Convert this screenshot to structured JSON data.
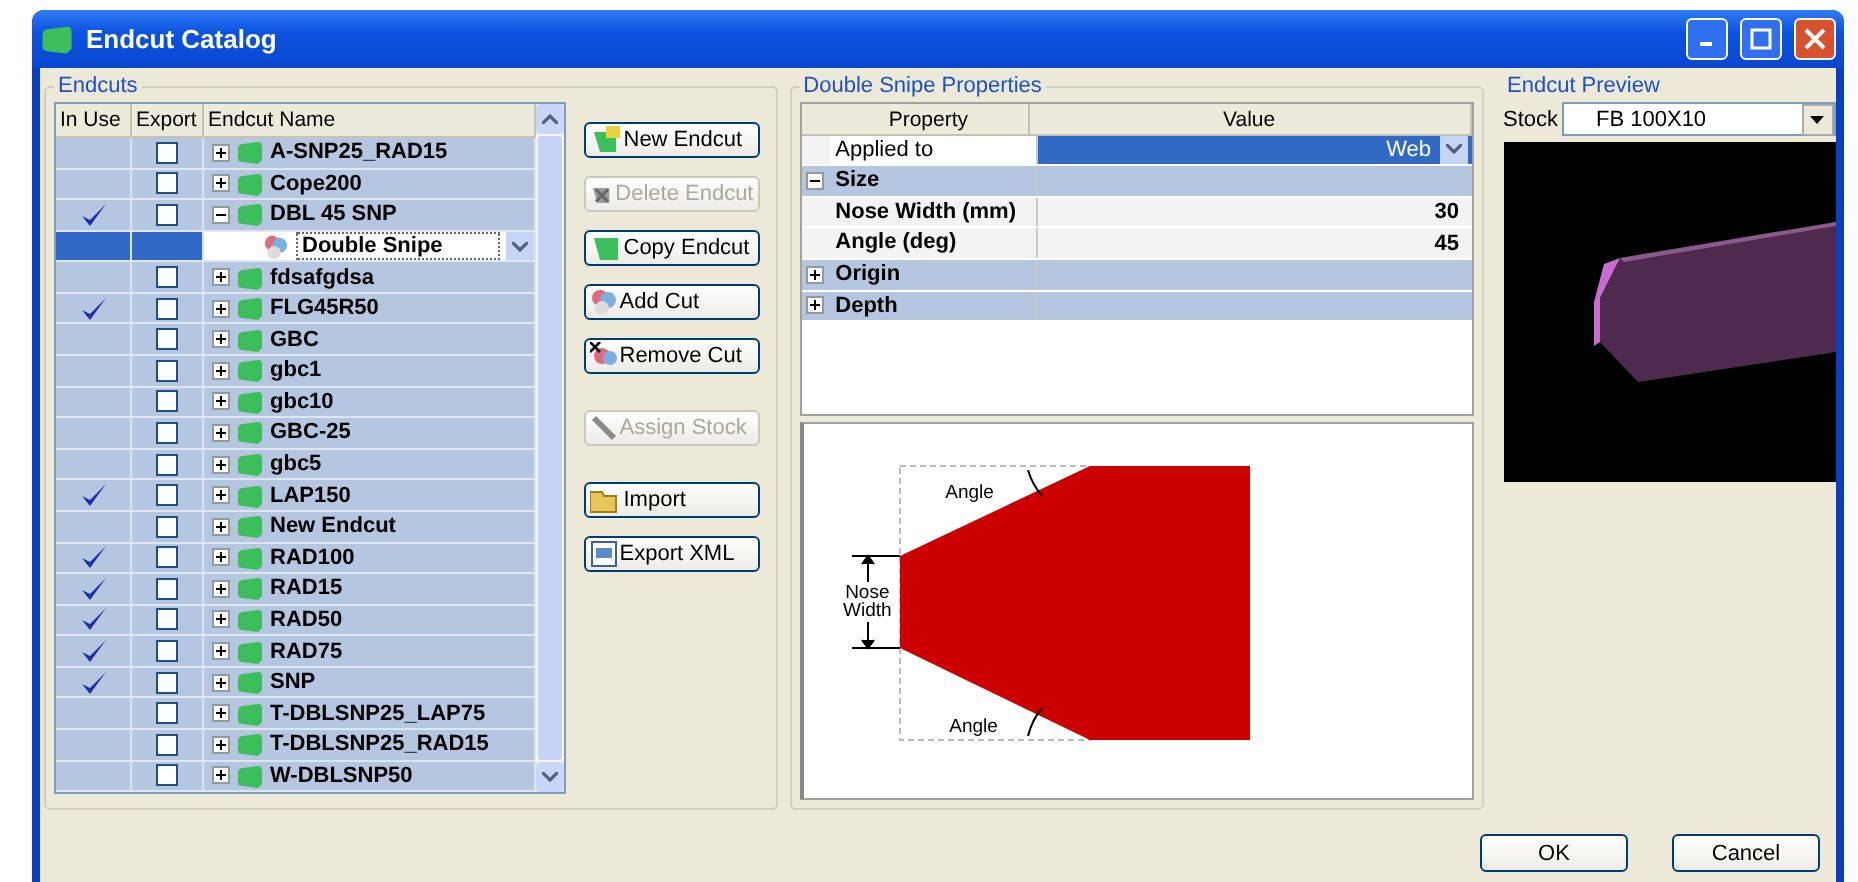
{
  "window": {
    "title": "Endcut Catalog"
  },
  "endcuts": {
    "title": "Endcuts",
    "columns": [
      "In Use",
      "Export",
      "Endcut Name"
    ],
    "rows": [
      {
        "name": "A-SNP25_RAD15",
        "in_use": false,
        "export": false,
        "expanded": false
      },
      {
        "name": "Cope200",
        "in_use": false,
        "export": false,
        "expanded": false
      },
      {
        "name": "DBL 45 SNP",
        "in_use": true,
        "export": false,
        "expanded": true,
        "children": [
          {
            "name": "Double Snipe",
            "selected": true
          }
        ]
      },
      {
        "name": "fdsafgdsa",
        "in_use": false,
        "export": false,
        "expanded": false
      },
      {
        "name": "FLG45R50",
        "in_use": true,
        "export": false,
        "expanded": false
      },
      {
        "name": "GBC",
        "in_use": false,
        "export": false,
        "expanded": false
      },
      {
        "name": "gbc1",
        "in_use": false,
        "export": false,
        "expanded": false
      },
      {
        "name": "gbc10",
        "in_use": false,
        "export": false,
        "expanded": false
      },
      {
        "name": "GBC-25",
        "in_use": false,
        "export": false,
        "expanded": false
      },
      {
        "name": "gbc5",
        "in_use": false,
        "export": false,
        "expanded": false
      },
      {
        "name": "LAP150",
        "in_use": true,
        "export": false,
        "expanded": false
      },
      {
        "name": "New Endcut",
        "in_use": false,
        "export": false,
        "expanded": false
      },
      {
        "name": "RAD100",
        "in_use": true,
        "export": false,
        "expanded": false
      },
      {
        "name": "RAD15",
        "in_use": true,
        "export": false,
        "expanded": false
      },
      {
        "name": "RAD50",
        "in_use": true,
        "export": false,
        "expanded": false
      },
      {
        "name": "RAD75",
        "in_use": true,
        "export": false,
        "expanded": false
      },
      {
        "name": "SNP",
        "in_use": true,
        "export": false,
        "expanded": false
      },
      {
        "name": "T-DBLSNP25_LAP75",
        "in_use": false,
        "export": false,
        "expanded": false
      },
      {
        "name": "T-DBLSNP25_RAD15",
        "in_use": false,
        "export": false,
        "expanded": false
      },
      {
        "name": "W-DBLSNP50",
        "in_use": false,
        "export": false,
        "expanded": false
      }
    ]
  },
  "action_groups": [
    [
      {
        "label": "New Endcut",
        "kind": "new",
        "disabled": false
      },
      {
        "label": "Delete Endcut",
        "kind": "delete",
        "disabled": true
      },
      {
        "label": "Copy Endcut",
        "kind": "copy",
        "disabled": false
      },
      {
        "label": "Add Cut",
        "kind": "add",
        "disabled": false
      },
      {
        "label": "Remove Cut",
        "kind": "remove",
        "disabled": false
      }
    ],
    [
      {
        "label": "Assign Stock",
        "kind": "assign",
        "disabled": true
      }
    ],
    [
      {
        "label": "Import",
        "kind": "import",
        "disabled": false
      },
      {
        "label": "Export XML",
        "kind": "export",
        "disabled": false
      }
    ]
  ],
  "properties": {
    "title": "Double Snipe Properties",
    "columns": [
      "Property",
      "Value"
    ],
    "rows": [
      {
        "kind": "choice",
        "name": "Applied to",
        "value": "Web",
        "selected": true
      },
      {
        "kind": "category",
        "name": "Size",
        "expanded": true
      },
      {
        "kind": "number",
        "name": "Nose Width (mm)",
        "value": "30"
      },
      {
        "kind": "number",
        "name": "Angle (deg)",
        "value": "45"
      },
      {
        "kind": "category",
        "name": "Origin",
        "expanded": false
      },
      {
        "kind": "category",
        "name": "Depth",
        "expanded": false
      }
    ],
    "diagram": {
      "top_angle": "Angle",
      "nose_width": "Nose Width",
      "bottom_angle": "Angle"
    }
  },
  "preview": {
    "title": "Endcut Preview",
    "stock_label": "Stock",
    "stock": "FB 100X10"
  },
  "buttons": [
    "OK",
    "Cancel"
  ]
}
